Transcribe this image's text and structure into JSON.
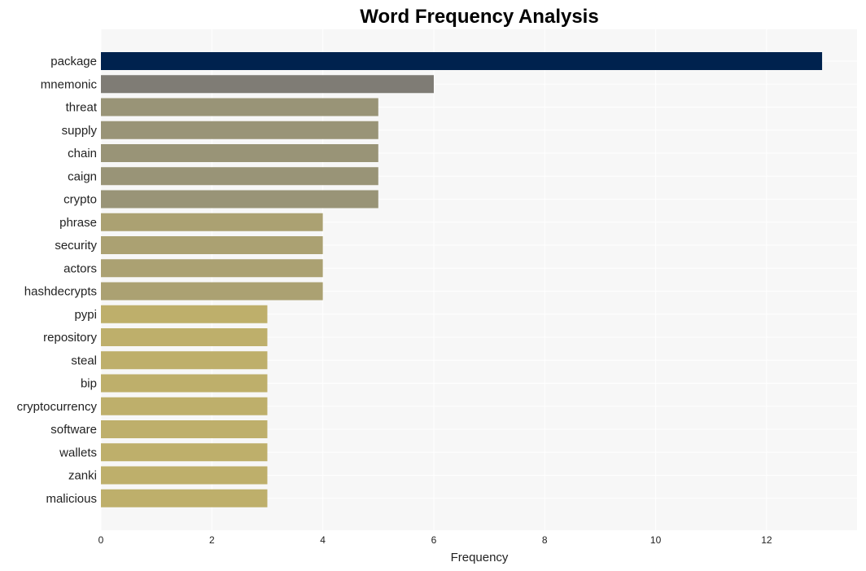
{
  "chart_data": {
    "type": "bar",
    "orientation": "horizontal",
    "title": "Word Frequency Analysis",
    "xlabel": "Frequency",
    "ylabel": "",
    "xlim": [
      0,
      13.63
    ],
    "xticks": [
      0,
      2,
      4,
      6,
      8,
      10,
      12
    ],
    "grid": true,
    "categories": [
      "package",
      "mnemonic",
      "threat",
      "supply",
      "chain",
      "caign",
      "crypto",
      "phrase",
      "security",
      "actors",
      "hashdecrypts",
      "pypi",
      "repository",
      "steal",
      "bip",
      "cryptocurrency",
      "software",
      "wallets",
      "zanki",
      "malicious"
    ],
    "values": [
      13,
      6,
      5,
      5,
      5,
      5,
      5,
      4,
      4,
      4,
      4,
      3,
      3,
      3,
      3,
      3,
      3,
      3,
      3,
      3
    ],
    "colors": {
      "13": "#00224e",
      "6": "#7f7c75",
      "5": "#999477",
      "4": "#aba172",
      "3": "#beaf6b"
    },
    "background": "#f7f7f7"
  }
}
